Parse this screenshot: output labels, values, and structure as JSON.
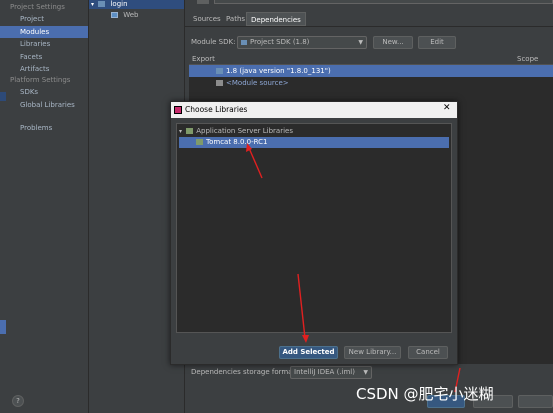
{
  "left_panel": {
    "project_settings_heading": "Project Settings",
    "project_settings_items": [
      "Project",
      "Modules",
      "Libraries",
      "Facets",
      "Artifacts"
    ],
    "platform_settings_heading": "Platform Settings",
    "platform_settings_items": [
      "SDKs",
      "Global Libraries"
    ],
    "problems_label": "Problems",
    "help_label": "?"
  },
  "module_tree": {
    "root_label": "login",
    "child_label": "Web"
  },
  "module_editor": {
    "tabs": [
      "Sources",
      "Paths",
      "Dependencies"
    ],
    "active_tab": "Dependencies",
    "module_sdk_label": "Module SDK:",
    "module_sdk_value": "Project SDK (1.8)",
    "new_button": "New...",
    "edit_button": "Edit",
    "table_header_export": "Export",
    "table_header_scope": "Scope",
    "rows": [
      "1.8 (java version \"1.8.0_131\")",
      "<Module source>"
    ],
    "storage_format_label": "Dependencies storage format:",
    "storage_format_value": "IntelliJ IDEA (.iml)"
  },
  "dialog": {
    "title": "Choose Libraries",
    "close_glyph": "✕",
    "group_label": "Application Server Libraries",
    "selected_item": "Tomcat 8.0.0-RC1",
    "add_selected_button": "Add Selected",
    "new_library_button": "New Library...",
    "cancel_button": "Cancel"
  },
  "watermark": "CSDN @肥宅小迷糊",
  "colors": {
    "selection": "#4b6eaf",
    "annotation_arrow": "#e02020",
    "background": "#3c3f41"
  }
}
